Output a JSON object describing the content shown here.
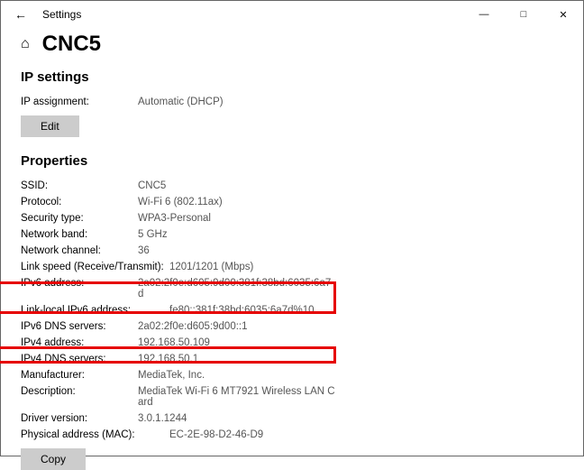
{
  "window": {
    "appTitle": "Settings"
  },
  "page": {
    "title": "CNC5",
    "ipSettings": {
      "heading": "IP settings",
      "assignmentLabel": "IP assignment:",
      "assignmentValue": "Automatic (DHCP)",
      "editButton": "Edit"
    },
    "properties": {
      "heading": "Properties",
      "rows": [
        {
          "label": "SSID:",
          "value": "CNC5"
        },
        {
          "label": "Protocol:",
          "value": "Wi-Fi 6 (802.11ax)"
        },
        {
          "label": "Security type:",
          "value": "WPA3-Personal"
        },
        {
          "label": "Network band:",
          "value": "5 GHz"
        },
        {
          "label": "Network channel:",
          "value": "36"
        },
        {
          "label": "Link speed (Receive/Transmit):",
          "value": "1201/1201 (Mbps)"
        },
        {
          "label": "IPv6 address:",
          "value": "2a02:2f0e:d605:9d00:381f:38bd:6035:6a7d"
        },
        {
          "label": "Link-local IPv6 address:",
          "value": "fe80::381f:38bd:6035:6a7d%10"
        },
        {
          "label": "IPv6 DNS servers:",
          "value": "2a02:2f0e:d605:9d00::1"
        },
        {
          "label": "IPv4 address:",
          "value": "192.168.50.109"
        },
        {
          "label": "IPv4 DNS servers:",
          "value": "192.168.50.1"
        },
        {
          "label": "Manufacturer:",
          "value": "MediaTek, Inc."
        },
        {
          "label": "Description:",
          "value": "MediaTek Wi-Fi 6 MT7921 Wireless LAN Card"
        },
        {
          "label": "Driver version:",
          "value": "3.0.1.1244"
        },
        {
          "label": "Physical address (MAC):",
          "value": "EC-2E-98-D2-46-D9"
        }
      ],
      "copyButton": "Copy"
    }
  }
}
